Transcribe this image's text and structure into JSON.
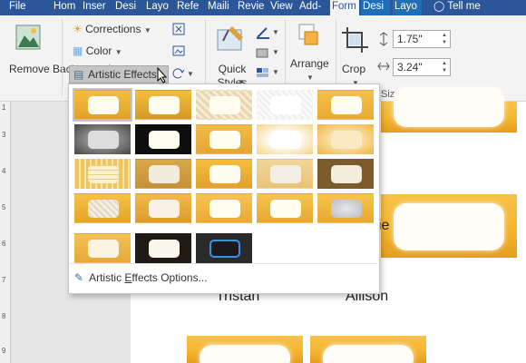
{
  "tabs": [
    "File",
    "Hom",
    "Inser",
    "Desi",
    "Layo",
    "Refe",
    "Maili",
    "Revie",
    "View",
    "Add-",
    "Form",
    "Desi",
    "Layo"
  ],
  "tell_me": "Tell me",
  "ribbon": {
    "remove_background": "Remove Background",
    "corrections": "Corrections",
    "color": "Color",
    "artistic_effects": "Artistic Effects",
    "quick_styles": "Quick Styles",
    "arrange": "Arrange",
    "crop": "Crop",
    "height": "1.75\"",
    "width": "3.24\"",
    "size_label": "Size"
  },
  "ruler": [
    "1",
    "3",
    "4",
    "5",
    "6",
    "7",
    "8",
    "9"
  ],
  "document": {
    "names": [
      "Tristan",
      "Allison"
    ],
    "fragments": [
      "n",
      "ie"
    ]
  },
  "dropdown": {
    "options_prefix": "Artistic ",
    "options_underlined": "E",
    "options_suffix": "ffects Options..."
  },
  "colors": {
    "tab_blue": "#2b579a",
    "ribbon_bg": "#f3f3f3",
    "card_gold": "#f5b531"
  }
}
